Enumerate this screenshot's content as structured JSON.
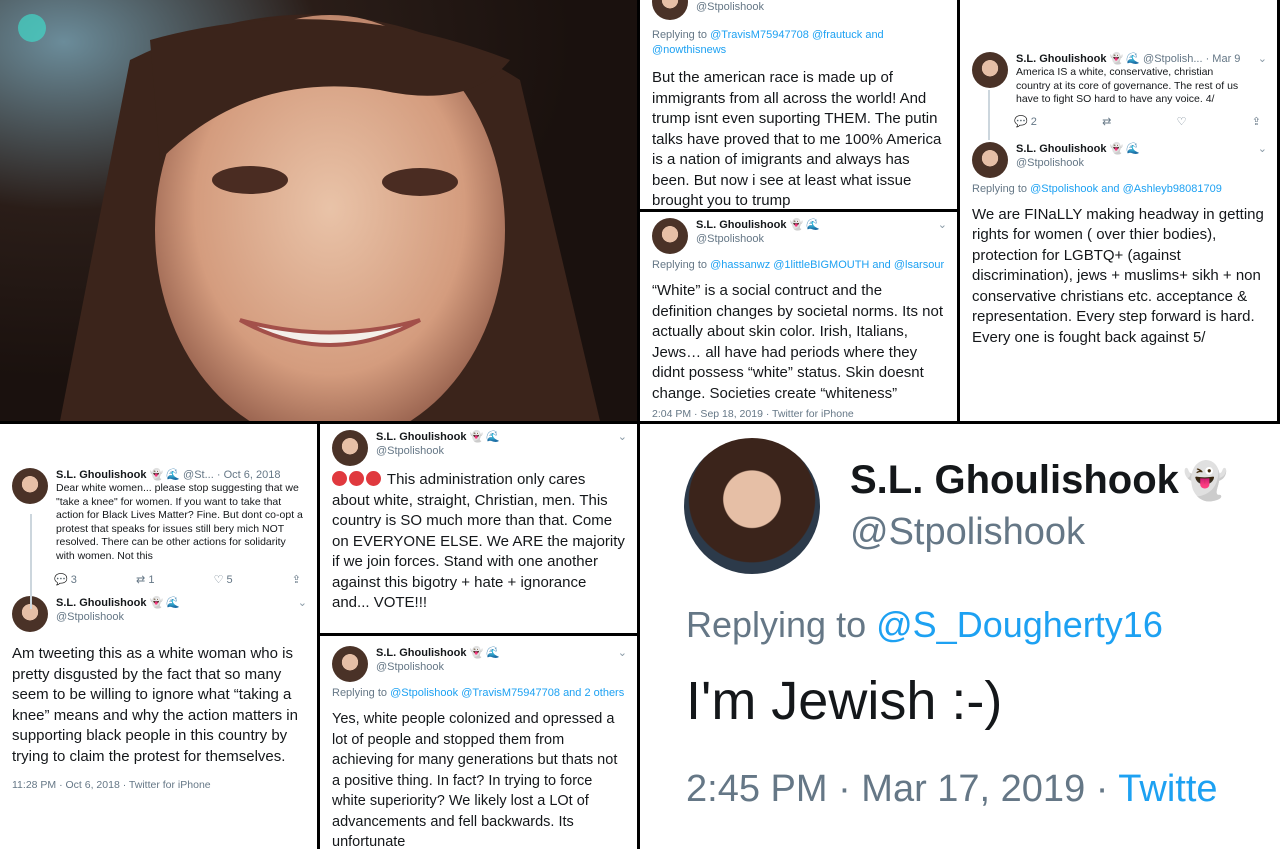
{
  "colors": {
    "link": "#1da1f2",
    "muted": "#657786",
    "text": "#14171a",
    "divider": "#000000"
  },
  "user": {
    "name": "S.L. Ghoulishook",
    "handle": "@Stpolishook"
  },
  "tweet_a": {
    "handle": "@Stpolishook",
    "reply_prefix": "Replying to",
    "reply_to": "@TravisM75947708 @frautuck and @nowthisnews",
    "body": "But the american race is made up of immigrants from all across the world! And trump isnt even suporting THEM. The putin talks have proved that to me 100% America is a nation of imigrants and always has been. But now i see at least what issue brought you to trump"
  },
  "tweet_b": {
    "name": "S.L. Ghoulishook",
    "handle": "@Stpolishook",
    "reply_prefix": "Replying to",
    "reply_to": "@hassanwz @1littleBIGMOUTH and @lsarsour",
    "body": "“White” is a social contruct and the definition changes by societal norms. Its not actually about skin color. Irish, Italians, Jews… all have had periods where they didnt possess “white” status. Skin doesnt change. Societies create “whiteness”",
    "meta": "2:04 PM · Sep 18, 2019 · Twitter for iPhone"
  },
  "tweet_c1": {
    "name": "S.L. Ghoulishook",
    "handle_short": "@Stpolish...",
    "date": "· Mar 9",
    "body": "America IS a white, conservative, christian country at its core of governance. The rest of us have to fight SO hard to have any voice. 4/",
    "replies": "2"
  },
  "tweet_c2": {
    "name": "S.L. Ghoulishook",
    "handle": "@Stpolishook",
    "reply_prefix": "Replying to",
    "reply_to": "@Stpolishook and @Ashleyb98081709",
    "body": "We are FINaLLY making headway in getting rights for women ( over thier bodies), protection for LGBTQ+ (against discrimination), jews + muslims+ sikh + non conservative christians etc. acceptance & representation. Every step forward is hard. Every one is fought back against 5/"
  },
  "tweet_d1": {
    "name": "S.L. Ghoulishook",
    "handle_short": "@St...",
    "date": "· Oct 6, 2018",
    "body": "Dear white women... please stop suggesting that we \"take a knee\" for women. If you want to take that action for Black Lives Matter? Fine. But dont co-opt a protest that speaks for issues still bery mich NOT resolved. There can be other actions for solidarity with women. Not this",
    "replies": "3",
    "retweets": "1",
    "likes": "5"
  },
  "tweet_d2": {
    "name": "S.L. Ghoulishook",
    "handle": "@Stpolishook",
    "body": "Am tweeting this as a white woman who is pretty disgusted by the fact that so many seem to be willing to ignore what “taking a knee” means and why the action matters in supporting black people in this country by trying to claim the protest for themselves.",
    "meta": "11:28 PM · Oct 6, 2018 · Twitter for iPhone"
  },
  "tweet_e": {
    "name": "S.L. Ghoulishook",
    "handle": "@Stpolishook",
    "body": "This administration only cares about white, straight, Christian, men. This country is SO much more than that. Come on EVERYONE ELSE. We ARE the majority if we join forces. Stand with one another against this bigotry + hate + ignorance and... VOTE!!!"
  },
  "tweet_f": {
    "name": "S.L. Ghoulishook",
    "handle": "@Stpolishook",
    "reply_prefix": "Replying to",
    "reply_to": "@Stpolishook @TravisM75947708 and 2 others",
    "body": "Yes, white people colonized and opressed a lot of people and stopped them from achieving for many generations but thats not a positive thing. In fact? In trying to force white superiority? We likely lost a LOt of advancements and fell backwards. Its unfortunate"
  },
  "tweet_g": {
    "name": "S.L. Ghoulishook",
    "handle": "@Stpolishook",
    "reply_prefix": "Replying to",
    "reply_to": "@S_Dougherty16",
    "body": "I'm Jewish :-)",
    "time": "2:45 PM · Mar 17, 2019 ·",
    "source": "Twitte"
  },
  "icons": [
    "reply-icon",
    "retweet-icon",
    "like-icon",
    "share-icon",
    "ghost-emoji",
    "wave-emoji",
    "chevron-down-icon",
    "angry-face-emoji"
  ]
}
